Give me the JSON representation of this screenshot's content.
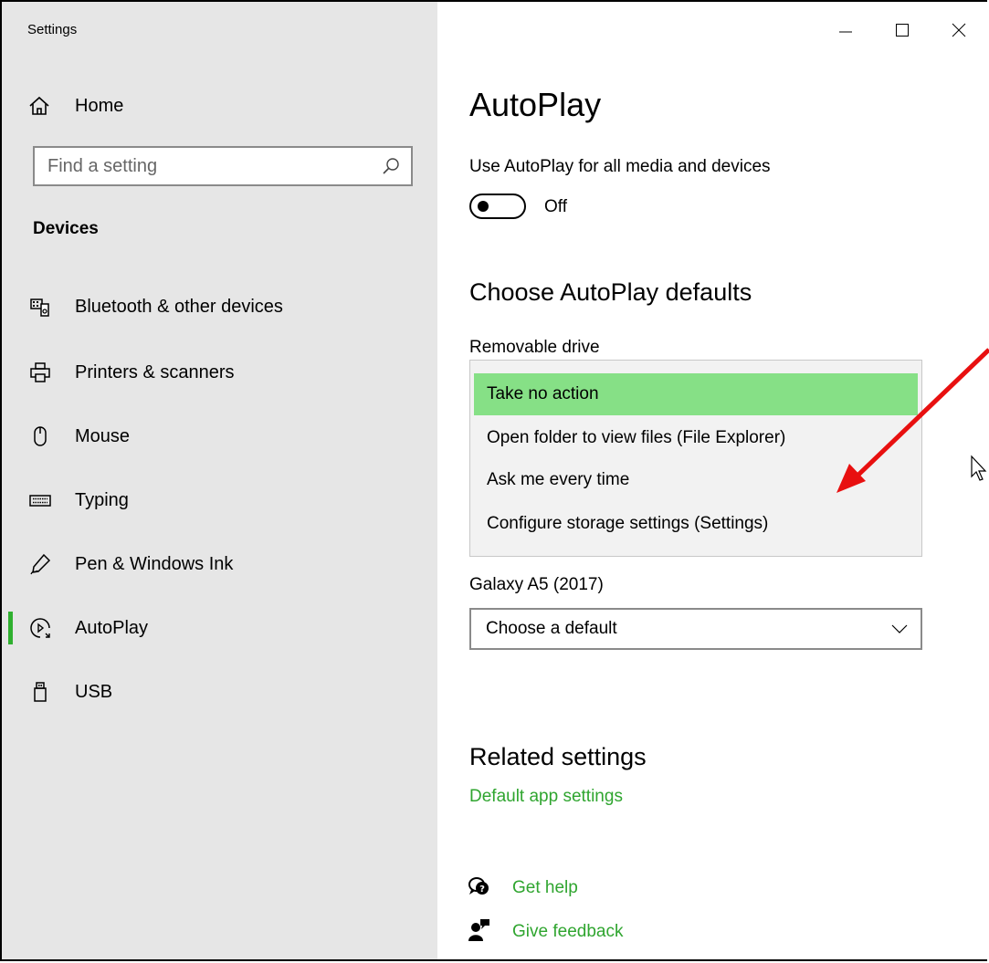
{
  "window": {
    "title": "Settings"
  },
  "sidebar": {
    "home_label": "Home",
    "search_placeholder": "Find a setting",
    "section_title": "Devices",
    "items": [
      {
        "label": "Bluetooth & other devices",
        "icon": "bluetooth-devices-icon"
      },
      {
        "label": "Printers & scanners",
        "icon": "printer-icon"
      },
      {
        "label": "Mouse",
        "icon": "mouse-icon"
      },
      {
        "label": "Typing",
        "icon": "keyboard-icon"
      },
      {
        "label": "Pen & Windows Ink",
        "icon": "pen-icon"
      },
      {
        "label": "AutoPlay",
        "icon": "autoplay-icon",
        "active": true
      },
      {
        "label": "USB",
        "icon": "usb-icon"
      }
    ]
  },
  "main": {
    "title": "AutoPlay",
    "use_autoplay_label": "Use AutoPlay for all media and devices",
    "toggle_state": "Off",
    "defaults_heading": "Choose AutoPlay defaults",
    "removable_drive_label": "Removable drive",
    "removable_options": [
      "Take no action",
      "Open folder to view files (File Explorer)",
      "Ask me every time",
      "Configure storage settings (Settings)"
    ],
    "selected_option": "Take no action",
    "galaxy_label": "Galaxy A5 (2017)",
    "galaxy_value": "Choose a default",
    "related_heading": "Related settings",
    "default_app_link": "Default app settings",
    "get_help": "Get help",
    "give_feedback": "Give feedback"
  },
  "colors": {
    "accent": "#2fa52f",
    "selected_option_bg": "#86e086",
    "sidebar_bg": "#e6e6e6",
    "annotation_arrow": "#e81010"
  }
}
